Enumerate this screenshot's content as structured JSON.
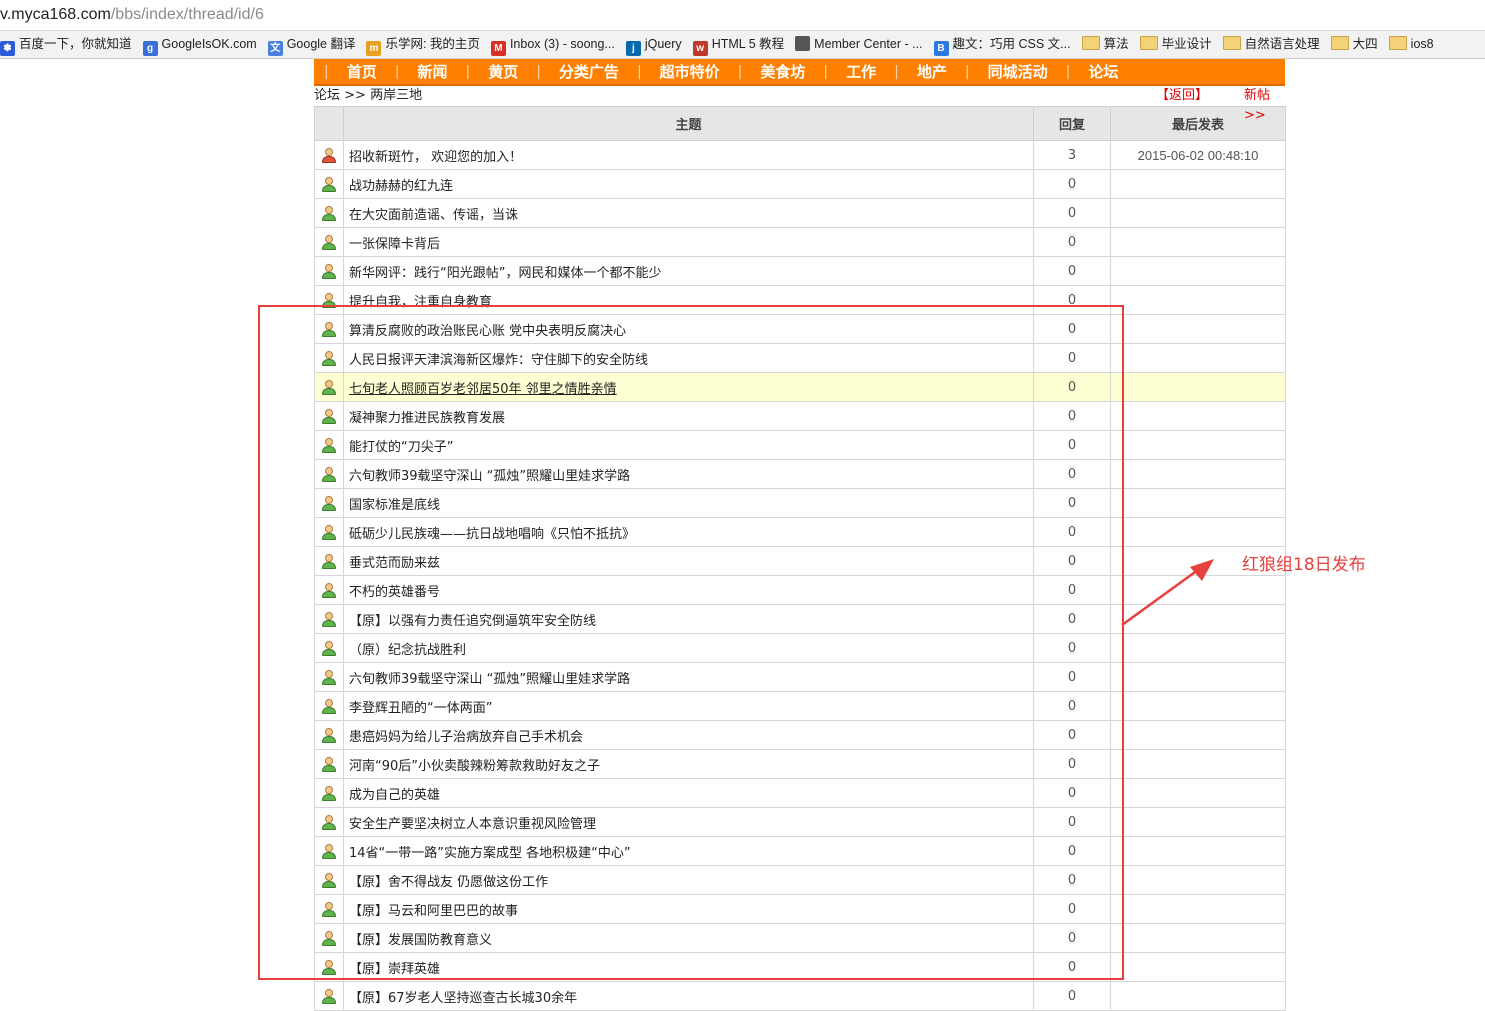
{
  "browser": {
    "url_host": "v.myca168.com",
    "url_path": "/bbs/index/thread/id/6",
    "bookmarks": [
      {
        "label": "百度一下，你就知道",
        "icon": "baidu-paw-icon",
        "color": "#2b5bd8",
        "glyph": "✽"
      },
      {
        "label": "GoogleIsOK.com",
        "icon": "google-g-icon",
        "color": "#3a6fd8",
        "glyph": "g"
      },
      {
        "label": "Google 翻译",
        "icon": "translate-icon",
        "color": "#4a80e0",
        "glyph": "文"
      },
      {
        "label": "乐学网: 我的主页",
        "icon": "lexue-icon",
        "color": "#e8a020",
        "glyph": "m"
      },
      {
        "label": "Inbox (3) - soong...",
        "icon": "gmail-icon",
        "color": "#d93025",
        "glyph": "M"
      },
      {
        "label": "jQuery",
        "icon": "jquery-icon",
        "color": "#0769ad",
        "glyph": "j"
      },
      {
        "label": "HTML 5 教程",
        "icon": "w3school-icon",
        "color": "#c0392b",
        "glyph": "w"
      },
      {
        "label": "Member Center - ...",
        "icon": "apple-icon",
        "color": "#555555",
        "glyph": ""
      },
      {
        "label": "趣文：巧用 CSS 文...",
        "icon": "bootstrap-b-icon",
        "color": "#2a7ae2",
        "glyph": "B"
      },
      {
        "label": "算法",
        "icon": "folder-icon",
        "folder": true
      },
      {
        "label": "毕业设计",
        "icon": "folder-icon",
        "folder": true
      },
      {
        "label": "自然语言处理",
        "icon": "folder-icon",
        "folder": true
      },
      {
        "label": "大四",
        "icon": "folder-icon",
        "folder": true
      },
      {
        "label": "ios8",
        "icon": "folder-icon",
        "folder": true
      }
    ]
  },
  "nav": [
    "首页",
    "新闻",
    "黄页",
    "分类广告",
    "超市特价",
    "美食坊",
    "工作",
    "地产",
    "同城活动",
    "论坛"
  ],
  "breadcrumb": {
    "root": "论坛",
    "sep": ">>",
    "current": "两岸三地"
  },
  "actions": {
    "back": "【返回】",
    "new_post": "新帖>>"
  },
  "table": {
    "headers": {
      "topic": "主题",
      "replies": "回复",
      "last_post": "最后发表"
    },
    "rows": [
      {
        "title": "招收新斑竹， 欢迎您的加入！",
        "replies": "3",
        "last": "2015-06-02 00:48:10",
        "avatar": "red"
      },
      {
        "title": "战功赫赫的红九连",
        "replies": "0",
        "last": ""
      },
      {
        "title": "在大灾面前造谣、传谣，当诛",
        "replies": "0",
        "last": ""
      },
      {
        "title": "一张保障卡背后",
        "replies": "0",
        "last": ""
      },
      {
        "title": "新华网评：践行“阳光跟帖”，网民和媒体一个都不能少",
        "replies": "0",
        "last": ""
      },
      {
        "title": "提升自我，注重自身教育",
        "replies": "0",
        "last": ""
      },
      {
        "title": "算清反腐败的政治账民心账 党中央表明反腐决心",
        "replies": "0",
        "last": ""
      },
      {
        "title": "人民日报评天津滨海新区爆炸：守住脚下的安全防线",
        "replies": "0",
        "last": ""
      },
      {
        "title": "七旬老人照顾百岁老邻居50年 邻里之情胜亲情",
        "replies": "0",
        "last": "",
        "highlight": true
      },
      {
        "title": "凝神聚力推进民族教育发展",
        "replies": "0",
        "last": ""
      },
      {
        "title": "能打仗的“刀尖子”",
        "replies": "0",
        "last": ""
      },
      {
        "title": "六旬教师39载坚守深山 “孤烛”照耀山里娃求学路",
        "replies": "0",
        "last": ""
      },
      {
        "title": "国家标准是底线",
        "replies": "0",
        "last": ""
      },
      {
        "title": "砥砺少儿民族魂——抗日战地唱响《只怕不抵抗》",
        "replies": "0",
        "last": ""
      },
      {
        "title": "垂式范而励来兹",
        "replies": "0",
        "last": ""
      },
      {
        "title": "不朽的英雄番号",
        "replies": "0",
        "last": ""
      },
      {
        "title": "【原】以强有力责任追究倒逼筑牢安全防线",
        "replies": "0",
        "last": ""
      },
      {
        "title": "（原）纪念抗战胜利",
        "replies": "0",
        "last": ""
      },
      {
        "title": "六旬教师39载坚守深山 “孤烛”照耀山里娃求学路",
        "replies": "0",
        "last": ""
      },
      {
        "title": "李登辉丑陋的“一体两面”",
        "replies": "0",
        "last": ""
      },
      {
        "title": "患癌妈妈为给儿子治病放弃自己手术机会",
        "replies": "0",
        "last": ""
      },
      {
        "title": "河南“90后”小伙卖酸辣粉筹款救助好友之子",
        "replies": "0",
        "last": ""
      },
      {
        "title": "成为自己的英雄",
        "replies": "0",
        "last": ""
      },
      {
        "title": "安全生产要坚决树立人本意识重视风险管理",
        "replies": "0",
        "last": ""
      },
      {
        "title": "14省“一带一路”实施方案成型 各地积极建“中心”",
        "replies": "0",
        "last": ""
      },
      {
        "title": "【原】舍不得战友 仍愿做这份工作",
        "replies": "0",
        "last": ""
      },
      {
        "title": "【原】马云和阿里巴巴的故事",
        "replies": "0",
        "last": ""
      },
      {
        "title": "【原】发展国防教育意义",
        "replies": "0",
        "last": ""
      },
      {
        "title": "【原】崇拜英雄",
        "replies": "0",
        "last": ""
      },
      {
        "title": "【原】67岁老人坚持巡查古长城30余年",
        "replies": "0",
        "last": ""
      }
    ]
  },
  "annotation": {
    "label": "红狼组18日发布",
    "color": "#e8403d"
  },
  "colors": {
    "nav_bg": "#ff7f00",
    "link_red": "#e00000",
    "highlight_row": "#ffffd4"
  }
}
